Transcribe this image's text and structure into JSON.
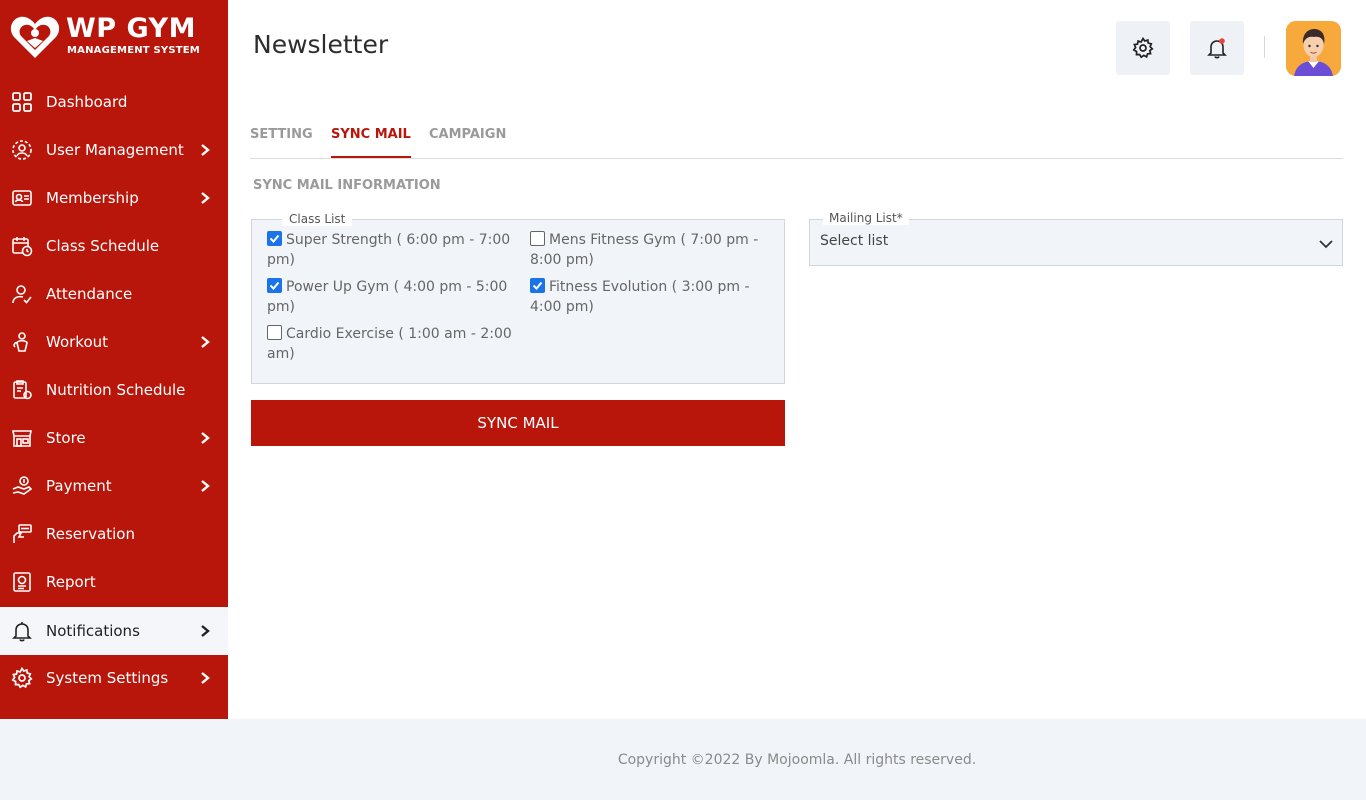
{
  "brand": {
    "title": "WP GYM",
    "subtitle": "MANAGEMENT SYSTEM",
    "color": "#b9160b"
  },
  "sidebar": {
    "items": [
      {
        "label": "Dashboard",
        "icon": "dashboard-icon",
        "has_submenu": false
      },
      {
        "label": "User Management",
        "icon": "user-management-icon",
        "has_submenu": true
      },
      {
        "label": "Membership",
        "icon": "membership-card-icon",
        "has_submenu": true
      },
      {
        "label": "Class Schedule",
        "icon": "calendar-icon",
        "has_submenu": false
      },
      {
        "label": "Attendance",
        "icon": "attendance-icon",
        "has_submenu": false
      },
      {
        "label": "Workout",
        "icon": "workout-icon",
        "has_submenu": true
      },
      {
        "label": "Nutrition Schedule",
        "icon": "nutrition-icon",
        "has_submenu": false
      },
      {
        "label": "Store",
        "icon": "store-icon",
        "has_submenu": true
      },
      {
        "label": "Payment",
        "icon": "payment-icon",
        "has_submenu": true
      },
      {
        "label": "Reservation",
        "icon": "reservation-icon",
        "has_submenu": false
      },
      {
        "label": "Report",
        "icon": "report-icon",
        "has_submenu": false
      },
      {
        "label": "Notifications",
        "icon": "bell-icon",
        "has_submenu": true,
        "active": true
      },
      {
        "label": "System Settings",
        "icon": "gear-icon",
        "has_submenu": true
      }
    ]
  },
  "header": {
    "title": "Newsletter",
    "settings_icon": "gear-icon",
    "notification_icon": "bell-icon",
    "avatar_icon": "user-avatar"
  },
  "tabs": [
    {
      "label": "SETTING",
      "active": false
    },
    {
      "label": "SYNC MAIL",
      "active": true
    },
    {
      "label": "CAMPAIGN",
      "active": false
    }
  ],
  "section_title": "SYNC MAIL INFORMATION",
  "class_list": {
    "legend": "Class List",
    "items": [
      {
        "label": "Super Strength ( 6:00 pm - 7:00 pm)",
        "checked": true
      },
      {
        "label": "Mens Fitness Gym ( 7:00 pm - 8:00 pm)",
        "checked": false
      },
      {
        "label": "Power Up Gym ( 4:00 pm - 5:00 pm)",
        "checked": true
      },
      {
        "label": "Fitness Evolution ( 3:00 pm - 4:00 pm)",
        "checked": true
      },
      {
        "label": "Cardio Exercise ( 1:00 am - 2:00 am)",
        "checked": false
      }
    ]
  },
  "sync_button": "SYNC MAIL",
  "mailing_list": {
    "legend": "Mailing List*",
    "value": "Select list"
  },
  "footer": {
    "copyright": "Copyright ©2022 By Mojoomla. All rights reserved."
  },
  "colors": {
    "accent": "#b9160b",
    "checkbox": "#1a73e8",
    "panel": "#f1f4f9"
  }
}
